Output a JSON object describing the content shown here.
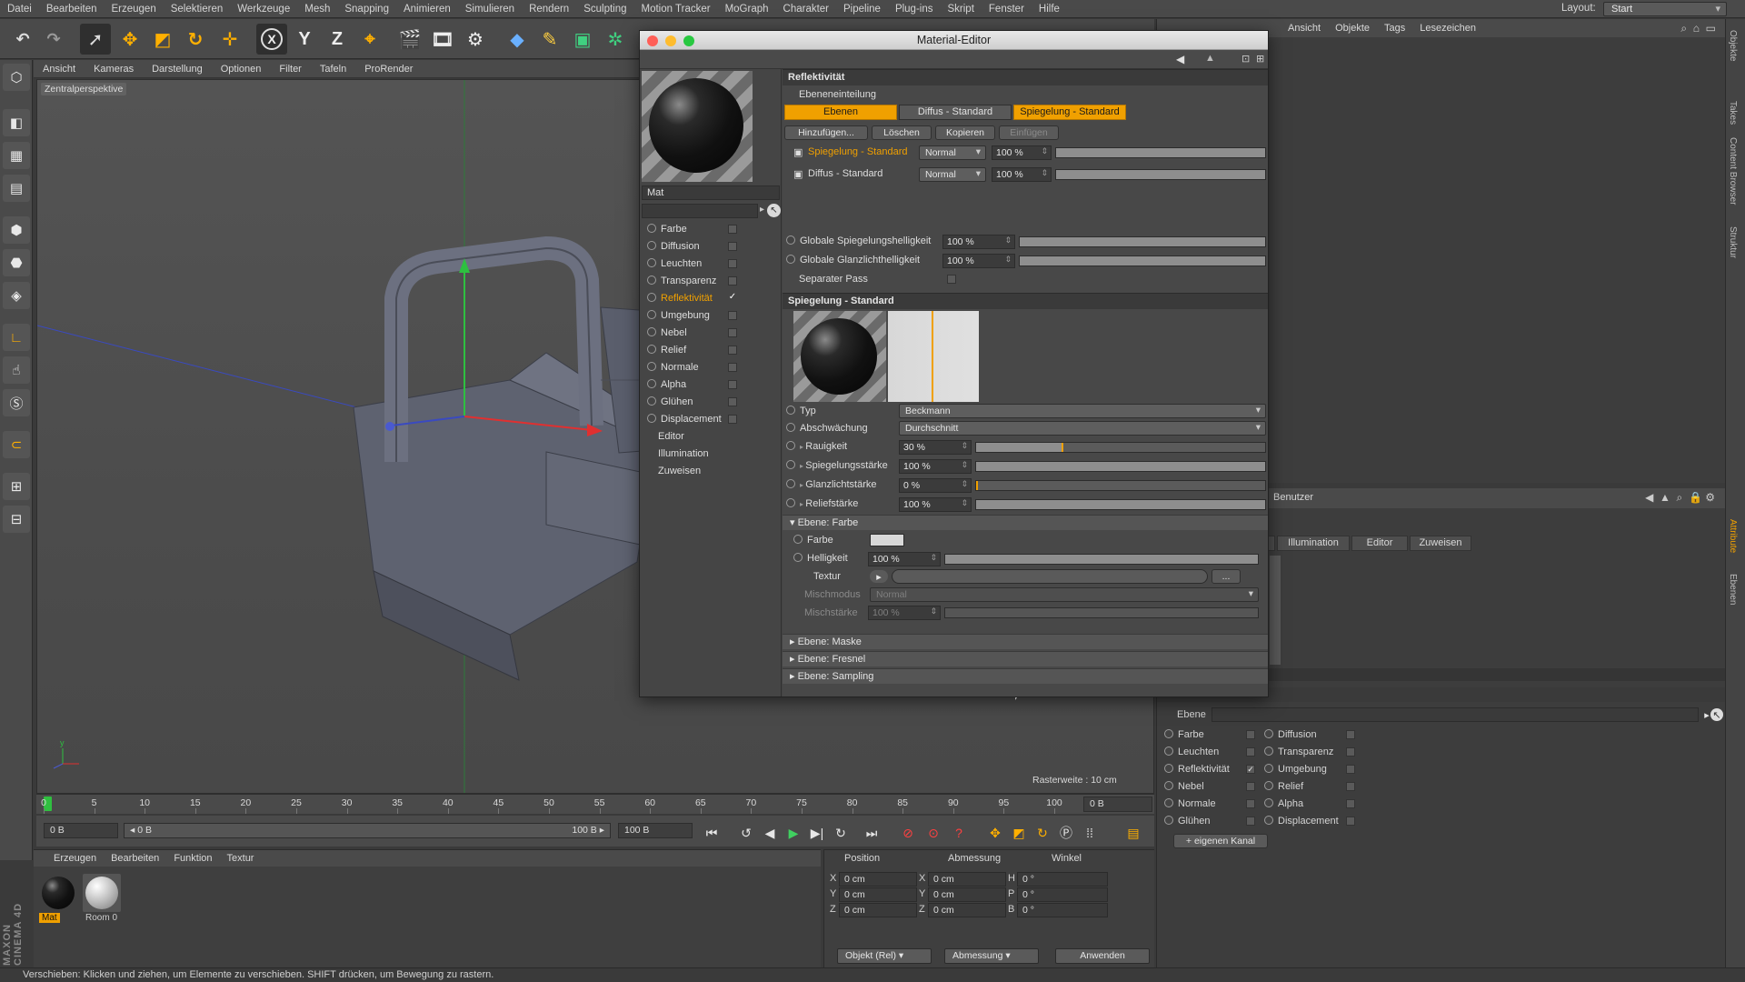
{
  "menubar": {
    "items": [
      "Datei",
      "Bearbeiten",
      "Erzeugen",
      "Selektieren",
      "Werkzeuge",
      "Mesh",
      "Snapping",
      "Animieren",
      "Simulieren",
      "Rendern",
      "Sculpting",
      "Motion Tracker",
      "MoGraph",
      "Charakter",
      "Pipeline",
      "Plug-ins",
      "Skript",
      "Fenster",
      "Hilfe"
    ],
    "layout_label": "Layout:",
    "layout_value": "Start"
  },
  "toolbar": {
    "x_label": "X",
    "y_label": "Y",
    "z_label": "Z"
  },
  "viewport": {
    "menu": [
      "Ansicht",
      "Kameras",
      "Darstellung",
      "Optionen",
      "Filter",
      "Tafeln",
      "ProRender"
    ],
    "label": "Zentralperspektive",
    "raster": "Rasterweite : 10 cm"
  },
  "timeline": {
    "ticks": [
      "0",
      "5",
      "10",
      "15",
      "20",
      "25",
      "30",
      "35",
      "40",
      "45",
      "50",
      "55",
      "60",
      "65",
      "70",
      "75",
      "80",
      "85",
      "90",
      "95",
      "100"
    ],
    "end_frame": "0 B"
  },
  "transport": {
    "current": "0 B",
    "range_start": "◂ 0 B",
    "range_end": "100 B ▸",
    "max": "100 B"
  },
  "material_manager": {
    "menu": [
      "Erzeugen",
      "Bearbeiten",
      "Funktion",
      "Textur"
    ],
    "materials": [
      "Mat",
      "Room 0"
    ]
  },
  "coordinates": {
    "headers": [
      "Position",
      "Abmessung",
      "Winkel"
    ],
    "rows": [
      {
        "axis": "X",
        "pos": "0 cm",
        "size_axis": "X",
        "size": "0 cm",
        "ang_axis": "H",
        "ang": "0 °"
      },
      {
        "axis": "Y",
        "pos": "0 cm",
        "size_axis": "Y",
        "size": "0 cm",
        "ang_axis": "P",
        "ang": "0 °"
      },
      {
        "axis": "Z",
        "pos": "0 cm",
        "size_axis": "Z",
        "size": "0 cm",
        "ang_axis": "B",
        "ang": "0 °"
      }
    ],
    "mode": "Objekt (Rel)",
    "size_mode": "Abmessung",
    "apply": "Anwenden"
  },
  "object_manager": {
    "menu": [
      "Ansicht",
      "Objekte",
      "Tags",
      "Lesezeichen"
    ]
  },
  "attribute_manager": {
    "user_label": "Benutzer",
    "tab_partial": "lt",
    "tabs": [
      "Illumination",
      "Editor",
      "Zuweisen"
    ],
    "ebene_label": "Ebene",
    "channels_left": [
      {
        "label": "Farbe",
        "checked": false
      },
      {
        "label": "Leuchten",
        "checked": false
      },
      {
        "label": "Reflektivität",
        "checked": true
      },
      {
        "label": "Nebel",
        "checked": false
      },
      {
        "label": "Normale",
        "checked": false
      },
      {
        "label": "Glühen",
        "checked": false
      }
    ],
    "channels_right": [
      {
        "label": "Diffusion",
        "checked": false
      },
      {
        "label": "Transparenz",
        "checked": false
      },
      {
        "label": "Umgebung",
        "checked": false
      },
      {
        "label": "Relief",
        "checked": false
      },
      {
        "label": "Alpha",
        "checked": false
      },
      {
        "label": "Displacement",
        "checked": false
      }
    ],
    "add_channel": "+ eigenen Kanal"
  },
  "side_tabs": [
    "Objekte",
    "Takes",
    "Content Browser",
    "Struktur",
    "Attribute",
    "Ebenen"
  ],
  "status": "Verschieben: Klicken und ziehen, um Elemente zu verschieben. SHIFT drücken, um Bewegung zu rastern.",
  "maxon": "MAXON CINEMA 4D",
  "material_editor": {
    "title": "Material-Editor",
    "material_name": "Mat",
    "channels": [
      {
        "label": "Farbe",
        "checked": false,
        "active": false
      },
      {
        "label": "Diffusion",
        "checked": false,
        "active": false
      },
      {
        "label": "Leuchten",
        "checked": false,
        "active": false
      },
      {
        "label": "Transparenz",
        "checked": false,
        "active": false
      },
      {
        "label": "Reflektivität",
        "checked": true,
        "active": true
      },
      {
        "label": "Umgebung",
        "checked": false,
        "active": false
      },
      {
        "label": "Nebel",
        "checked": false,
        "active": false
      },
      {
        "label": "Relief",
        "checked": false,
        "active": false
      },
      {
        "label": "Normale",
        "checked": false,
        "active": false
      },
      {
        "label": "Alpha",
        "checked": false,
        "active": false
      },
      {
        "label": "Glühen",
        "checked": false,
        "active": false
      },
      {
        "label": "Displacement",
        "checked": false,
        "active": false
      }
    ],
    "extras": [
      "Editor",
      "Illumination",
      "Zuweisen"
    ],
    "reflect": {
      "section": "Reflektivität",
      "layer_group": "Ebeneneinteilung",
      "tabs": [
        "Ebenen",
        "Diffus - Standard",
        "Spiegelung - Standard"
      ],
      "buttons": [
        "Hinzufügen...",
        "Löschen",
        "Kopieren",
        "Einfügen"
      ],
      "layers": [
        {
          "name": "Spiegelung - Standard",
          "mode": "Normal",
          "value": "100 %",
          "fraction": 1.0,
          "active": true
        },
        {
          "name": "Diffus - Standard",
          "mode": "Normal",
          "value": "100 %",
          "fraction": 1.0,
          "active": false
        }
      ],
      "global_spec_label": "Globale Spiegelungshelligkeit",
      "global_spec_value": "100 %",
      "global_spec_fraction": 1.0,
      "global_gloss_label": "Globale Glanzlichthelligkeit",
      "global_gloss_value": "100 %",
      "global_gloss_fraction": 1.0,
      "separate_pass_label": "Separater Pass"
    },
    "layer": {
      "section": "Spiegelung - Standard",
      "type_label": "Typ",
      "type_value": "Beckmann",
      "atten_label": "Abschwächung",
      "atten_value": "Durchschnitt",
      "params": [
        {
          "label": "Rauigkeit",
          "value": "30 %",
          "fraction": 0.3
        },
        {
          "label": "Spiegelungsstärke",
          "value": "100 %",
          "fraction": 1.0
        },
        {
          "label": "Glanzlichtstärke",
          "value": "0 %",
          "fraction": 0.0
        },
        {
          "label": "Reliefstärke",
          "value": "100 %",
          "fraction": 1.0
        }
      ],
      "color_section": "Ebene: Farbe",
      "color_label": "Farbe",
      "color_value": "#d8d8d8",
      "brightness_label": "Helligkeit",
      "brightness_value": "100 %",
      "brightness_fraction": 1.0,
      "texture_label": "Textur",
      "texture_button": "...",
      "blend_mode_label": "Mischmodus",
      "blend_mode_value": "Normal",
      "blend_strength_label": "Mischstärke",
      "blend_strength_value": "100 %",
      "collapsed": [
        "Ebene: Maske",
        "Ebene: Fresnel",
        "Ebene: Sampling"
      ]
    }
  },
  "colors": {
    "accent": "#f0a000",
    "panel": "#444444",
    "text": "#d8d8d8"
  }
}
